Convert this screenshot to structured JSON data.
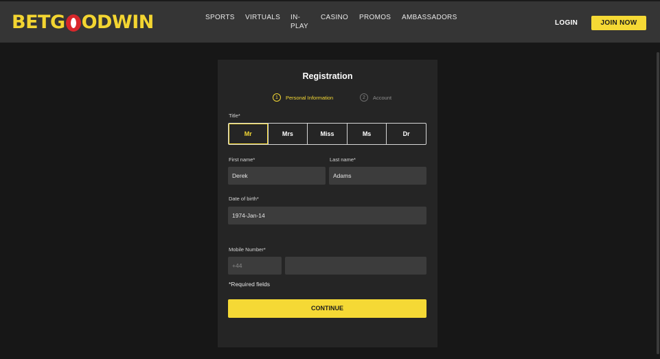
{
  "header": {
    "logo": {
      "part1": "BETG",
      "part2": "ODWIN"
    },
    "nav": [
      "SPORTS",
      "VIRTUALS",
      "IN-PLAY",
      "CASINO",
      "PROMOS",
      "AMBASSADORS"
    ],
    "login_label": "LOGIN",
    "join_label": "JOIN NOW"
  },
  "form": {
    "title": "Registration",
    "steps": [
      {
        "number": "1",
        "label": "Personal Information",
        "active": true
      },
      {
        "number": "2",
        "label": "Account",
        "active": false
      }
    ],
    "title_label": "Title*",
    "title_options": [
      "Mr",
      "Mrs",
      "Miss",
      "Ms",
      "Dr"
    ],
    "title_selected": "Mr",
    "first_name_label": "First name*",
    "first_name_value": "Derek",
    "last_name_label": "Last name*",
    "last_name_value": "Adams",
    "dob_label": "Date of birth*",
    "dob_value": "1974-Jan-14",
    "mobile_label": "Mobile Number*",
    "mobile_prefix_placeholder": "+44",
    "mobile_number_value": "",
    "required_note": "*Required fields",
    "continue_label": "CONTINUE"
  },
  "colors": {
    "accent": "#f5d935",
    "logo_red": "#d8272b",
    "header_bg": "#353535",
    "page_bg": "#171717",
    "panel_bg": "#252525",
    "input_bg": "#3c3c3c"
  }
}
